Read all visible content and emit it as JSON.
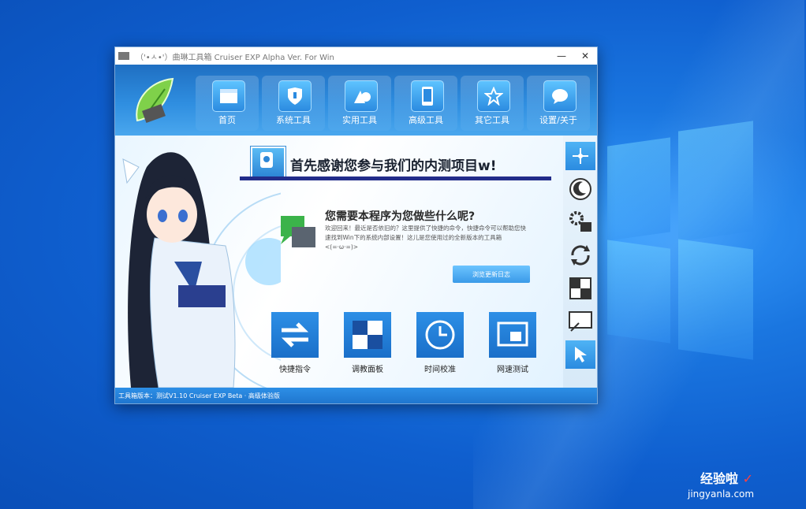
{
  "window": {
    "title": "（'•ㅅ•'）曲琳工具箱 Cruiser EXP Alpha Ver. For Win",
    "minimize": "—",
    "close": "✕"
  },
  "nav": [
    {
      "label": "首页",
      "icon": "window-icon"
    },
    {
      "label": "系统工具",
      "icon": "shield-icon"
    },
    {
      "label": "实用工具",
      "icon": "shapes-icon"
    },
    {
      "label": "高级工具",
      "icon": "tablet-icon"
    },
    {
      "label": "其它工具",
      "icon": "star-icon"
    },
    {
      "label": "设置/关于",
      "icon": "chat-bubble-icon"
    }
  ],
  "content": {
    "headline": "首先感谢您参与我们的内测项目w!",
    "question": "您需要本程序为您做些什么呢?",
    "description": "欢迎回来！最近是否依旧的？这里提供了快捷的命令，快捷命令可以帮助您快速找到Win下的系统内部设置！这儿是您使用过的全新版本的工具箱 <(=·ω·=)>",
    "link_button": "浏览更新日志",
    "tiles": [
      {
        "label": "快捷指令",
        "icon": "swap-arrows-icon"
      },
      {
        "label": "调教面板",
        "icon": "panel-grid-icon"
      },
      {
        "label": "时间校准",
        "icon": "clock-icon"
      },
      {
        "label": "网速测试",
        "icon": "speed-test-icon"
      }
    ]
  },
  "sidebar": [
    {
      "icon": "move-arrows-icon"
    },
    {
      "icon": "moon-icon"
    },
    {
      "icon": "settings-gears-icon"
    },
    {
      "icon": "refresh-icon"
    },
    {
      "icon": "checker-icon"
    },
    {
      "icon": "screen-cast-icon"
    },
    {
      "icon": "cursor-icon"
    }
  ],
  "status": {
    "text": "工具箱版本：测试V1.10 Cruiser EXP Beta · 高级体验版"
  },
  "watermark": {
    "brand": "经验啦",
    "url": "jingyanla.com",
    "check": "✓"
  }
}
